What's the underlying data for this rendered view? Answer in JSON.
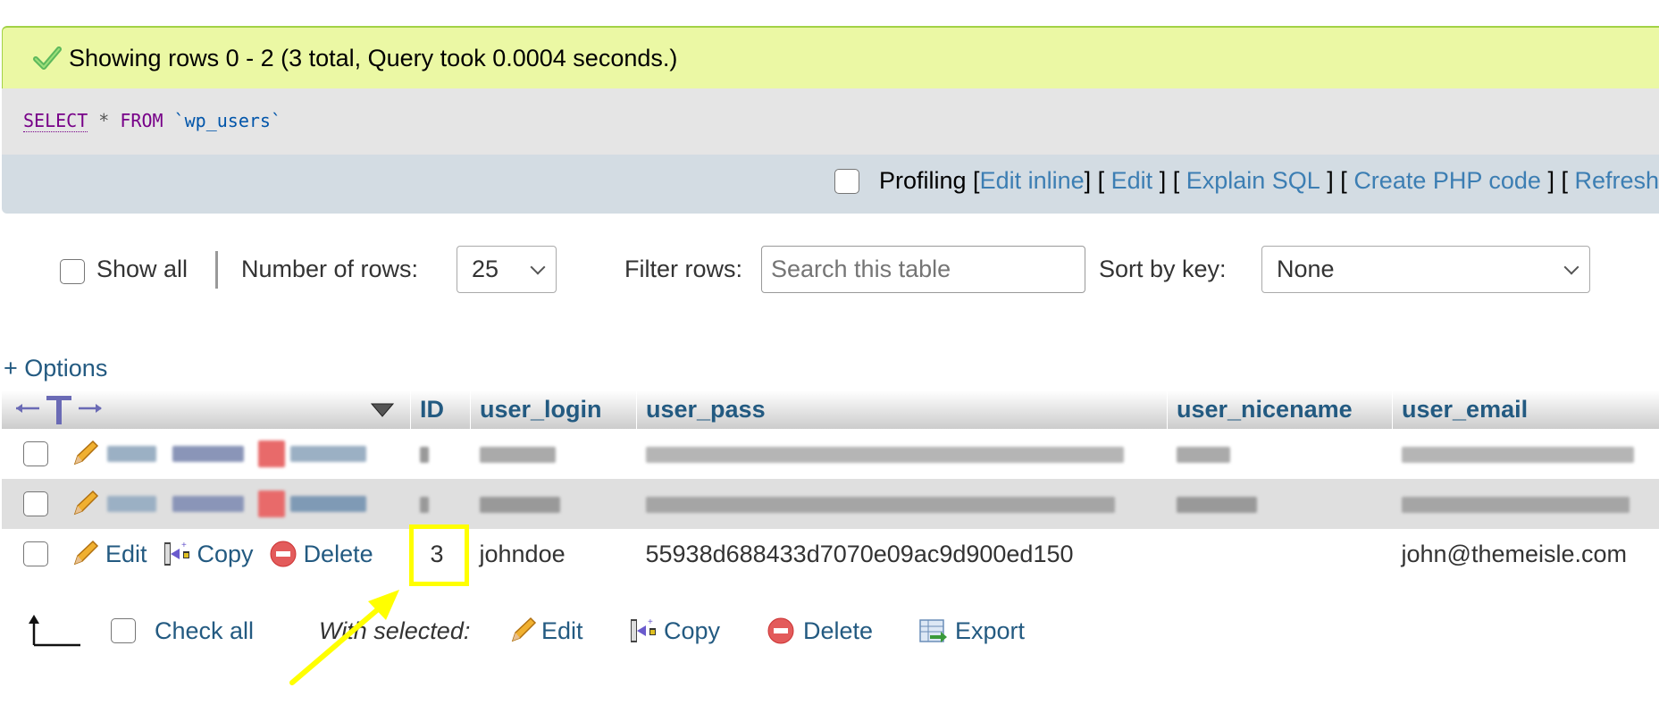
{
  "success": {
    "icon": "check-icon",
    "message": "Showing rows 0 - 2 (3 total, Query took 0.0004 seconds.)"
  },
  "sql": {
    "select": "SELECT",
    "star": " * ",
    "from": "FROM",
    "table": " `wp_users`"
  },
  "profiling": {
    "label": "Profiling",
    "open1": " [",
    "edit_inline": "Edit inline",
    "sep1": "] [ ",
    "edit": "Edit",
    "sep2": " ] [ ",
    "explain": "Explain SQL",
    "sep3": " ] [ ",
    "create_php": "Create PHP code",
    "sep4": " ] [ ",
    "refresh": "Refresh"
  },
  "controls": {
    "show_all": "Show all",
    "number_of_rows_label": "Number of rows:",
    "number_of_rows_value": "25",
    "filter_label": "Filter rows:",
    "filter_placeholder": "Search this table",
    "sort_label": "Sort by key:",
    "sort_value": "None"
  },
  "options_link": "+ Options",
  "table": {
    "columns": [
      "ID",
      "user_login",
      "user_pass",
      "user_nicename",
      "user_email"
    ],
    "row_actions": {
      "edit": "Edit",
      "copy": "Copy",
      "delete": "Delete"
    },
    "rows": [
      {
        "blurred": true
      },
      {
        "blurred": true
      },
      {
        "blurred": false,
        "ID": "3",
        "user_login": "johndoe",
        "user_pass": "55938d688433d7070e09ac9d900ed150",
        "user_nicename": "",
        "user_email": "john@themeisle.com"
      }
    ]
  },
  "footer": {
    "check_all": "Check all",
    "with_selected": "With selected:",
    "edit": "Edit",
    "copy": "Copy",
    "delete": "Delete",
    "export": "Export"
  },
  "annotation": {
    "highlight_color": "#ffff00",
    "arrow_color": "#ffff00"
  }
}
